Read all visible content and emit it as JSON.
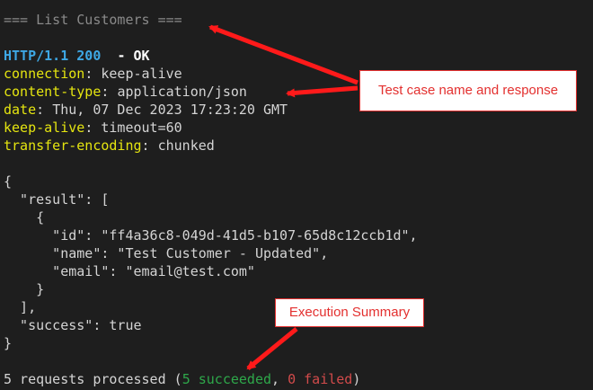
{
  "terminal": {
    "test_header": "=== List Customers ===",
    "status": {
      "protocol": "HTTP/1.1 200",
      "text": "- OK"
    },
    "headers": [
      {
        "key": "connection",
        "value": "keep-alive"
      },
      {
        "key": "content-type",
        "value": "application/json"
      },
      {
        "key": "date",
        "value": "Thu, 07 Dec 2023 17:23:20 GMT"
      },
      {
        "key": "keep-alive",
        "value": "timeout=60"
      },
      {
        "key": "transfer-encoding",
        "value": "chunked"
      }
    ],
    "body_lines": [
      "{",
      "  \"result\": [",
      "    {",
      "      \"id\": \"ff4a36c8-049d-41d5-b107-65d8c12ccb1d\",",
      "      \"name\": \"Test Customer - Updated\",",
      "      \"email\": \"email@test.com\"",
      "    }",
      "  ],",
      "  \"success\": true",
      "}"
    ],
    "summary": {
      "count": "5",
      "prefix": " requests processed (",
      "succeeded": "5 succeeded",
      "separator": ", ",
      "failed": "0 failed",
      "suffix": ")"
    }
  },
  "annotations": {
    "callout_1": "Test case name and response",
    "callout_2": "Execution Summary",
    "color": "#e3302f"
  }
}
